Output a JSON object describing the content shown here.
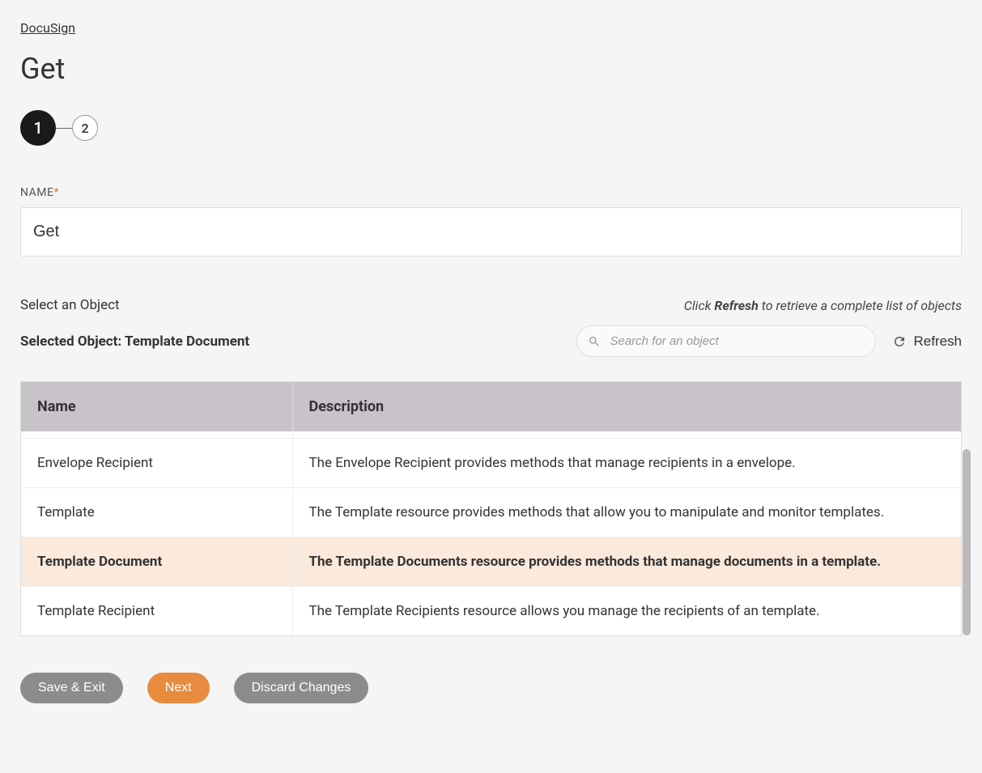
{
  "breadcrumb": "DocuSign",
  "page_title": "Get",
  "stepper": {
    "step1": "1",
    "step2": "2"
  },
  "name_field": {
    "label": "NAME",
    "value": "Get"
  },
  "select_object": {
    "label": "Select an Object",
    "hint_prefix": "Click ",
    "hint_bold": "Refresh",
    "hint_suffix": " to retrieve a complete list of objects"
  },
  "selected_object": {
    "prefix": "Selected Object: ",
    "value": "Template Document"
  },
  "search": {
    "placeholder": "Search for an object"
  },
  "refresh_label": "Refresh",
  "table": {
    "headers": {
      "name": "Name",
      "description": "Description"
    },
    "rows": [
      {
        "name": "Envelope Recipient",
        "description": "The Envelope Recipient provides methods that manage recipients in a envelope.",
        "selected": false
      },
      {
        "name": "Template",
        "description": "The Template resource provides methods that allow you to manipulate and monitor templates.",
        "selected": false
      },
      {
        "name": "Template Document",
        "description": "The Template Documents resource provides methods that manage documents in a template.",
        "selected": true
      },
      {
        "name": "Template Recipient",
        "description": "The Template Recipients resource allows you manage the recipients of an template.",
        "selected": false
      }
    ]
  },
  "buttons": {
    "save_exit": "Save & Exit",
    "next": "Next",
    "discard": "Discard Changes"
  }
}
